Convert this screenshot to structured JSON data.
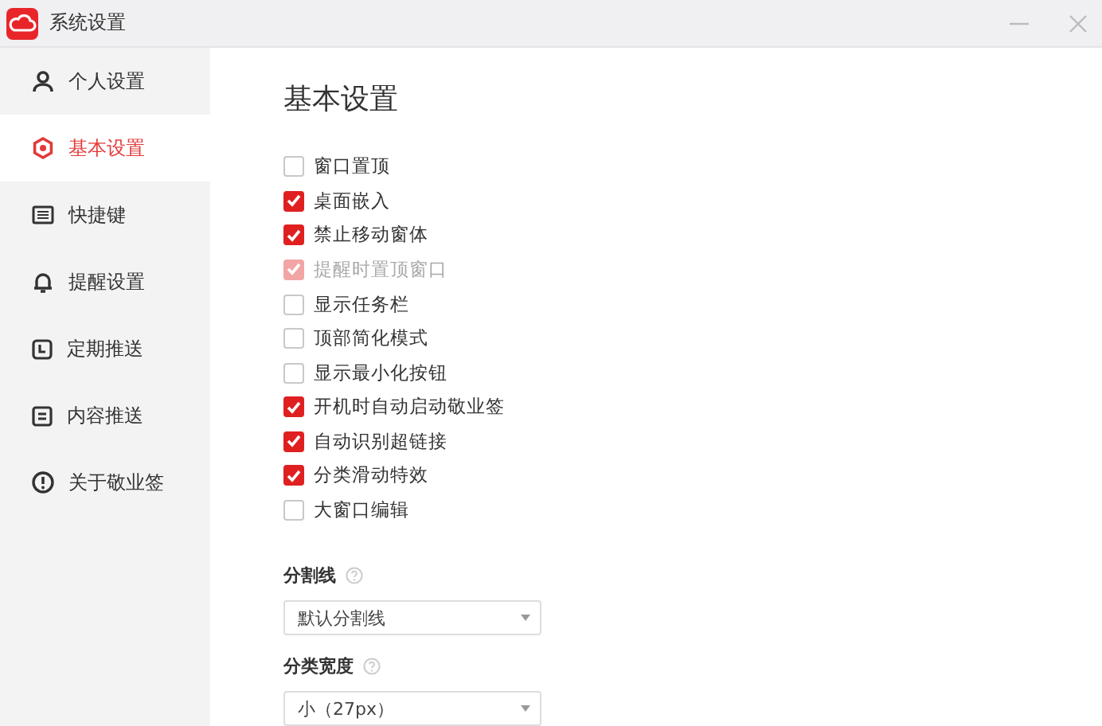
{
  "window": {
    "title": "系统设置"
  },
  "sidebar": {
    "items": [
      {
        "label": "个人设置",
        "selected": false
      },
      {
        "label": "基本设置",
        "selected": true
      },
      {
        "label": "快捷键",
        "selected": false
      },
      {
        "label": "提醒设置",
        "selected": false
      },
      {
        "label": "定期推送",
        "selected": false
      },
      {
        "label": "内容推送",
        "selected": false
      },
      {
        "label": "关于敬业签",
        "selected": false
      }
    ]
  },
  "main": {
    "heading": "基本设置",
    "options": [
      {
        "label": "窗口置顶",
        "checked": false,
        "disabled": false
      },
      {
        "label": "桌面嵌入",
        "checked": true,
        "disabled": false
      },
      {
        "label": "禁止移动窗体",
        "checked": true,
        "disabled": false
      },
      {
        "label": "提醒时置顶窗口",
        "checked": true,
        "disabled": true
      },
      {
        "label": "显示任务栏",
        "checked": false,
        "disabled": false
      },
      {
        "label": "顶部简化模式",
        "checked": false,
        "disabled": false
      },
      {
        "label": "显示最小化按钮",
        "checked": false,
        "disabled": false
      },
      {
        "label": "开机时自动启动敬业签",
        "checked": true,
        "disabled": false
      },
      {
        "label": "自动识别超链接",
        "checked": true,
        "disabled": false
      },
      {
        "label": "分类滑动特效",
        "checked": true,
        "disabled": false
      },
      {
        "label": "大窗口编辑",
        "checked": false,
        "disabled": false
      }
    ],
    "selects": [
      {
        "label": "分割线",
        "value": "默认分割线"
      },
      {
        "label": "分类宽度",
        "value": "小（27px）"
      }
    ]
  }
}
